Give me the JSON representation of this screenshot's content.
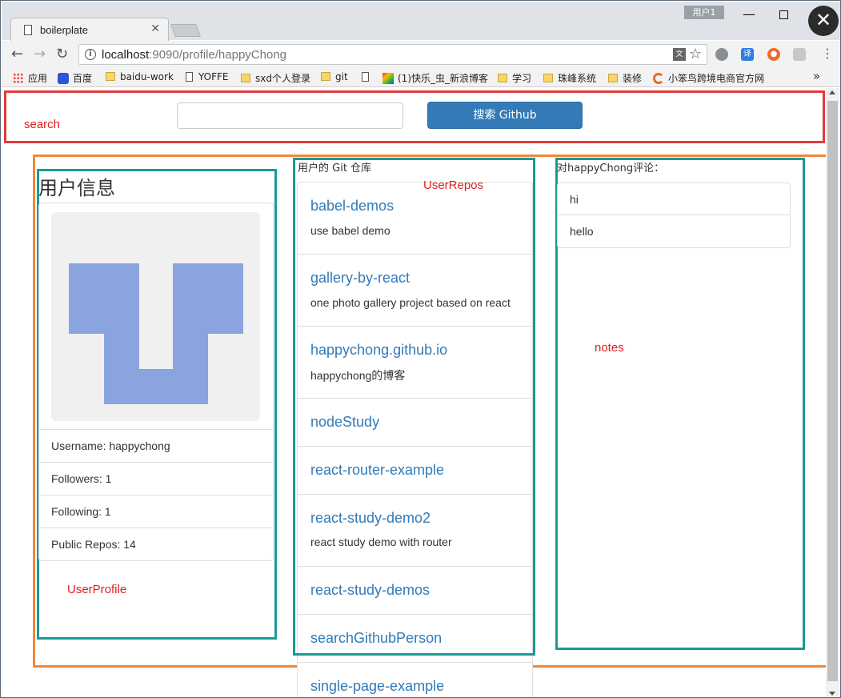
{
  "browser": {
    "tab_title": "boilerplate",
    "user_badge": "用户1",
    "url_host": "localhost",
    "url_path": ":9090/profile/happyChong"
  },
  "bookmarks": [
    {
      "label": "应用",
      "icon": "apps-icon"
    },
    {
      "label": "百度",
      "icon": "paw-icon"
    },
    {
      "label": "baidu-work",
      "icon": "folder-icon"
    },
    {
      "label": "YOFFE",
      "icon": "page-icon"
    },
    {
      "label": "sxd个人登录",
      "icon": "folder-icon"
    },
    {
      "label": "git",
      "icon": "folder-icon"
    },
    {
      "label": "",
      "icon": "page-icon"
    },
    {
      "label": "(1)快乐_虫_新浪博客",
      "icon": "site-icon"
    },
    {
      "label": "学习",
      "icon": "folder-icon"
    },
    {
      "label": "珠峰系统",
      "icon": "folder-icon"
    },
    {
      "label": "装修",
      "icon": "folder-icon"
    },
    {
      "label": "小笨鸟跨境电商官方网",
      "icon": "swirl-icon"
    }
  ],
  "annotations": {
    "search": "search",
    "user_repos": "UserRepos",
    "notes": "notes",
    "user_profile": "UserProfile"
  },
  "search": {
    "input_value": "",
    "button_label": "搜索 Github"
  },
  "profile": {
    "title": "用户信息",
    "avatar_color": "#8aa4e0",
    "rows": [
      "Username: happychong",
      "Followers: 1",
      "Following: 1",
      "Public Repos: 14"
    ]
  },
  "repos": {
    "heading": "用户的 Git 仓库",
    "items": [
      {
        "name": "babel-demos",
        "desc": "use babel demo"
      },
      {
        "name": "gallery-by-react",
        "desc": "one photo gallery project based on react"
      },
      {
        "name": "happychong.github.io",
        "desc": "happychong的博客"
      },
      {
        "name": "nodeStudy",
        "desc": ""
      },
      {
        "name": "react-router-example",
        "desc": ""
      },
      {
        "name": "react-study-demo2",
        "desc": "react study demo with router"
      },
      {
        "name": "react-study-demos",
        "desc": ""
      },
      {
        "name": "searchGithubPerson",
        "desc": ""
      },
      {
        "name": "single-page-example",
        "desc": ""
      }
    ]
  },
  "notes": {
    "heading": "对happyChong评论：",
    "items": [
      "hi",
      "hello"
    ]
  }
}
